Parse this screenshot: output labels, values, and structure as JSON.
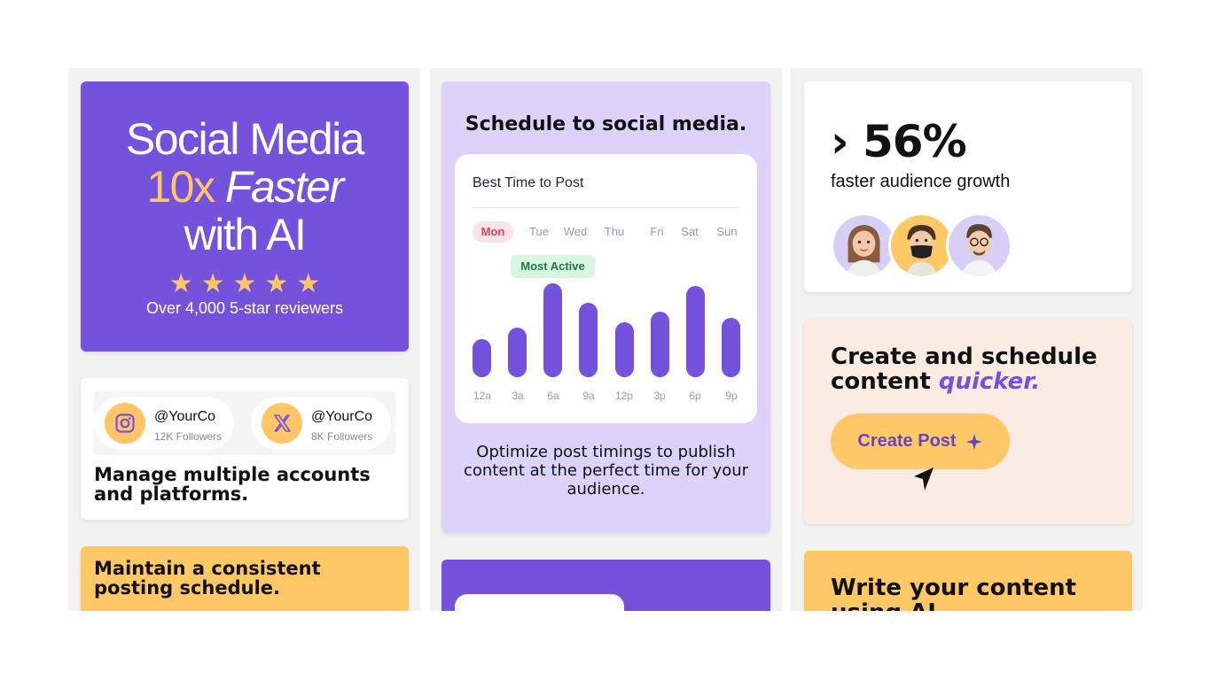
{
  "hero": {
    "line1": "Social Media",
    "line2_accent": "10x",
    "line2_italic": "Faster",
    "line3": "with AI",
    "stars": "★★★★★",
    "reviews": "Over 4,000 5-star reviewers"
  },
  "accounts": {
    "items": [
      {
        "icon": "instagram-icon",
        "handle": "@YourCo",
        "followers": "12K Followers"
      },
      {
        "icon": "x-icon",
        "handle": "@YourCo",
        "followers": "8K Followers"
      }
    ],
    "title": "Manage multiple accounts and platforms."
  },
  "consistent": {
    "title": "Maintain a consistent posting schedule."
  },
  "schedule": {
    "heading": "Schedule to social media.",
    "card_title": "Best Time to Post",
    "days": [
      "Mon",
      "Tue",
      "Wed",
      "Thu",
      "Fri",
      "Sat",
      "Sun"
    ],
    "active_day": "Mon",
    "badge": "Most Active",
    "hours": [
      "12a",
      "3a",
      "6a",
      "9a",
      "12p",
      "3p",
      "6p",
      "9p"
    ],
    "activity": [
      0.38,
      0.5,
      0.95,
      0.75,
      0.55,
      0.66,
      0.92,
      0.6
    ],
    "description": "Optimize post timings to publish content at the perfect time for your audience."
  },
  "stat": {
    "value": "› 56%",
    "caption": "faster audience growth"
  },
  "create": {
    "title_plain": "Create and schedule content",
    "title_accent": "quicker.",
    "button": "Create Post",
    "button_icon": "sparkle-icon"
  },
  "write": {
    "title": "Write your content using AI"
  },
  "colors": {
    "brand_purple": "#7452dc",
    "accent_yellow": "#ffc567",
    "lavender": "#ddd3fa",
    "peach": "#faece2"
  }
}
